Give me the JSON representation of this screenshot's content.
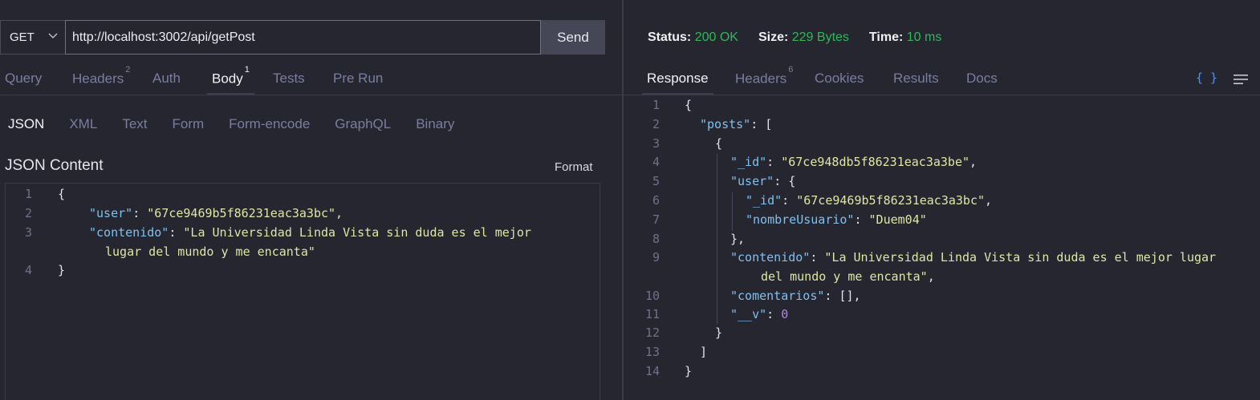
{
  "request": {
    "method": "GET",
    "url": "http://localhost:3002/api/getPost",
    "send_label": "Send"
  },
  "request_tabs": [
    {
      "label": "Query",
      "badge": ""
    },
    {
      "label": "Headers",
      "badge": "2"
    },
    {
      "label": "Auth",
      "badge": ""
    },
    {
      "label": "Body",
      "badge": "1",
      "active": true
    },
    {
      "label": "Tests",
      "badge": ""
    },
    {
      "label": "Pre Run",
      "badge": ""
    }
  ],
  "body_types": [
    "JSON",
    "XML",
    "Text",
    "Form",
    "Form-encode",
    "GraphQL",
    "Binary"
  ],
  "body": {
    "section_label": "JSON Content",
    "format_label": "Format"
  },
  "response": {
    "status_label": "Status:",
    "status_value": "200 OK",
    "size_label": "Size:",
    "size_value": "229 Bytes",
    "time_label": "Time:",
    "time_value": "10 ms",
    "tabs": [
      {
        "label": "Response",
        "badge": "",
        "active": true
      },
      {
        "label": "Headers",
        "badge": "6"
      },
      {
        "label": "Cookies",
        "badge": ""
      },
      {
        "label": "Results",
        "badge": ""
      },
      {
        "label": "Docs",
        "badge": ""
      }
    ],
    "icons": [
      "braces-icon",
      "wrap-lines-icon"
    ],
    "braces_glyph": "{ }"
  },
  "request_body_lines": [
    {
      "n": "1",
      "text": "{"
    },
    {
      "n": "2",
      "key": "\"user\"",
      "value": "\"67ce9469b5f86231eac3a3bc\","
    },
    {
      "n": "3",
      "key": "\"contenido\"",
      "value": "\"La Universidad Linda Vista sin duda es el mejor",
      "cont": "lugar del mundo y me encanta\""
    },
    {
      "n": "4",
      "text": "}"
    }
  ],
  "response_body_lines": [
    {
      "n": "1",
      "text": "{"
    },
    {
      "n": "2",
      "key": "\"posts\"",
      "tail": ": ["
    },
    {
      "n": "3",
      "text": "{"
    },
    {
      "n": "4",
      "key": "\"_id\"",
      "value": "\"67ce948db5f86231eac3a3be\"",
      "tail": ","
    },
    {
      "n": "5",
      "key": "\"user\"",
      "tail": ": {"
    },
    {
      "n": "6",
      "key": "\"_id\"",
      "value": "\"67ce9469b5f86231eac3a3bc\"",
      "tail": ","
    },
    {
      "n": "7",
      "key": "\"nombreUsuario\"",
      "value": "\"Duem04\""
    },
    {
      "n": "8",
      "text": "},"
    },
    {
      "n": "9",
      "key": "\"contenido\"",
      "value": "\"La Universidad Linda Vista sin duda es el mejor lugar",
      "cont": "del mundo y me encanta\"",
      "cont_tail": ","
    },
    {
      "n": "10",
      "key": "\"comentarios\"",
      "tail": ": [],"
    },
    {
      "n": "11",
      "key": "\"__v\"",
      "number": "0"
    },
    {
      "n": "12",
      "text": "}"
    },
    {
      "n": "13",
      "text": "]"
    },
    {
      "n": "14",
      "text": "}"
    }
  ],
  "colors": {
    "background": "#262631",
    "status_ok": "#2fb85a",
    "json_key": "#7fc0ee",
    "json_string": "#dfe6a4",
    "json_number": "#b186e0",
    "line_number": "#6f718c",
    "tab_inactive": "#7b7da0"
  }
}
